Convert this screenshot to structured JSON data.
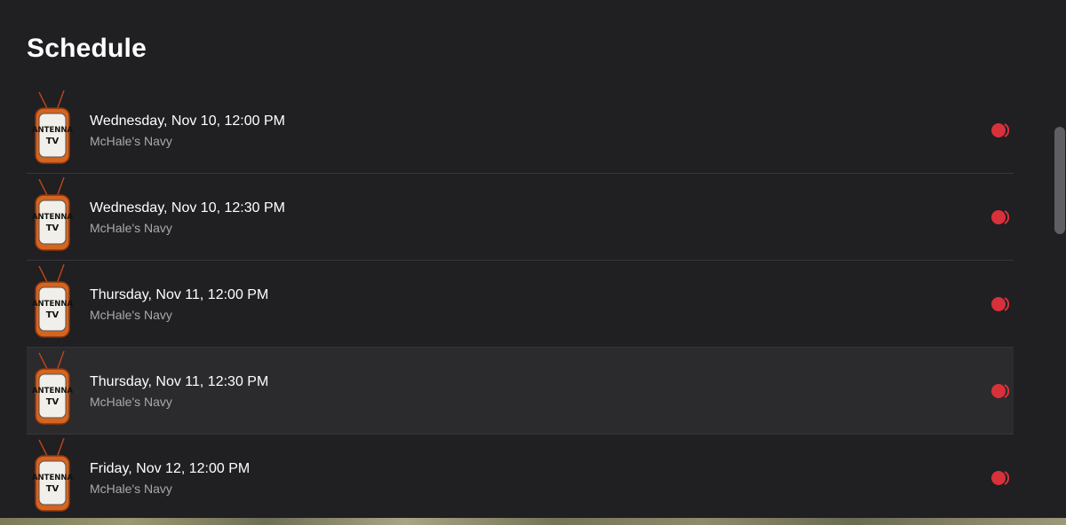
{
  "page": {
    "title": "Schedule"
  },
  "channel": {
    "logo_line1": "ANTENNA",
    "logo_line2": "TV"
  },
  "colors": {
    "background": "#201f22",
    "record_accent": "#d8313a",
    "highlight_row": "#2b2a2d",
    "subtitle": "#a9a8ad"
  },
  "schedule": [
    {
      "time": "Wednesday, Nov 10, 12:00 PM",
      "show": "McHale's Navy",
      "icon": "record-icon"
    },
    {
      "time": "Wednesday, Nov 10, 12:30 PM",
      "show": "McHale's Navy",
      "icon": "record-icon"
    },
    {
      "time": "Thursday, Nov 11, 12:00 PM",
      "show": "McHale's Navy",
      "icon": "record-icon"
    },
    {
      "time": "Thursday, Nov 11, 12:30 PM",
      "show": "McHale's Navy",
      "icon": "record-icon",
      "highlighted": true
    },
    {
      "time": "Friday, Nov 12, 12:00 PM",
      "show": "McHale's Navy",
      "icon": "record-icon"
    }
  ]
}
